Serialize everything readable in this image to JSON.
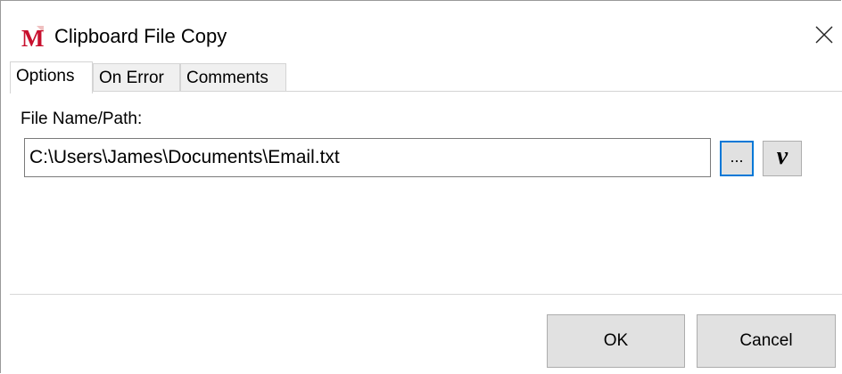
{
  "window": {
    "title": "Clipboard File Copy",
    "icon": "macro-m-app-icon",
    "close_icon": "close-icon"
  },
  "tabs": [
    {
      "label": "Options",
      "active": true
    },
    {
      "label": "On Error",
      "active": false
    },
    {
      "label": "Comments",
      "active": false
    }
  ],
  "options": {
    "file_label": "File Name/Path:",
    "file_value": "C:\\Users\\James\\Documents\\Email.txt",
    "browse_label": "...",
    "variable_label": "v"
  },
  "footer": {
    "ok_label": "OK",
    "cancel_label": "Cancel"
  },
  "colors": {
    "focus_border": "#0078d7",
    "button_bg": "#e1e1e1",
    "icon_red": "#c8102e"
  }
}
